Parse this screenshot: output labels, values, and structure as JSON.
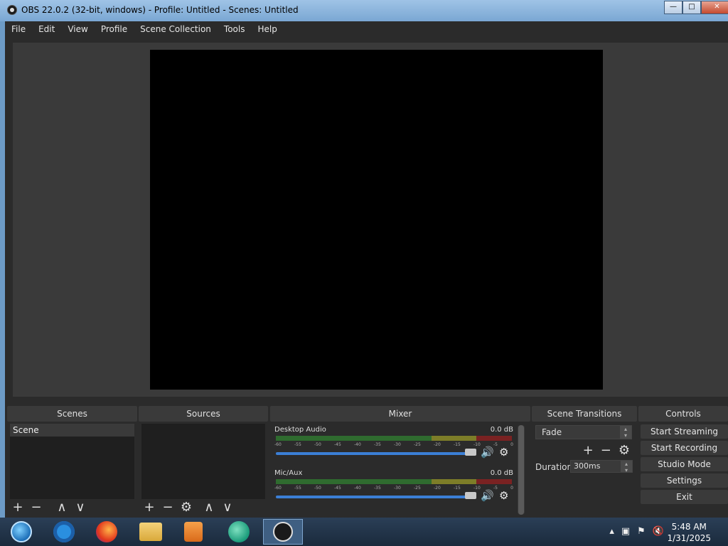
{
  "window": {
    "title": "OBS 22.0.2 (32-bit, windows) - Profile: Untitled - Scenes: Untitled",
    "controls": {
      "minimize": "—",
      "maximize": "□",
      "close": "✕"
    }
  },
  "menu": [
    "File",
    "Edit",
    "View",
    "Profile",
    "Scene Collection",
    "Tools",
    "Help"
  ],
  "docks": {
    "scenes": {
      "title": "Scenes",
      "items": [
        "Scene"
      ]
    },
    "sources": {
      "title": "Sources"
    },
    "mixer": {
      "title": "Mixer",
      "ticks": [
        "-60",
        "-55",
        "-50",
        "-45",
        "-40",
        "-35",
        "-30",
        "-25",
        "-20",
        "-15",
        "-10",
        "-5",
        "0"
      ],
      "channels": [
        {
          "name": "Desktop Audio",
          "db": "0.0 dB",
          "volume_fraction": 0.98
        },
        {
          "name": "Mic/Aux",
          "db": "0.0 dB",
          "volume_fraction": 0.98
        }
      ]
    },
    "transitions": {
      "title": "Scene Transitions",
      "selected": "Fade",
      "duration_label": "Duration",
      "duration_value": "300ms"
    },
    "controls": {
      "title": "Controls",
      "buttons": [
        "Start Streaming",
        "Start Recording",
        "Studio Mode",
        "Settings",
        "Exit"
      ]
    }
  },
  "icons": {
    "add": "+",
    "remove": "−",
    "up": "∧",
    "down": "∨",
    "gear": "⚙",
    "speaker": "🔊"
  },
  "taskbar": {
    "time": "5:48 AM",
    "date": "1/31/2025"
  },
  "colors": {
    "accent": "#3b7fd6",
    "panel": "#2b2b2b",
    "preview_bg": "#000000"
  }
}
